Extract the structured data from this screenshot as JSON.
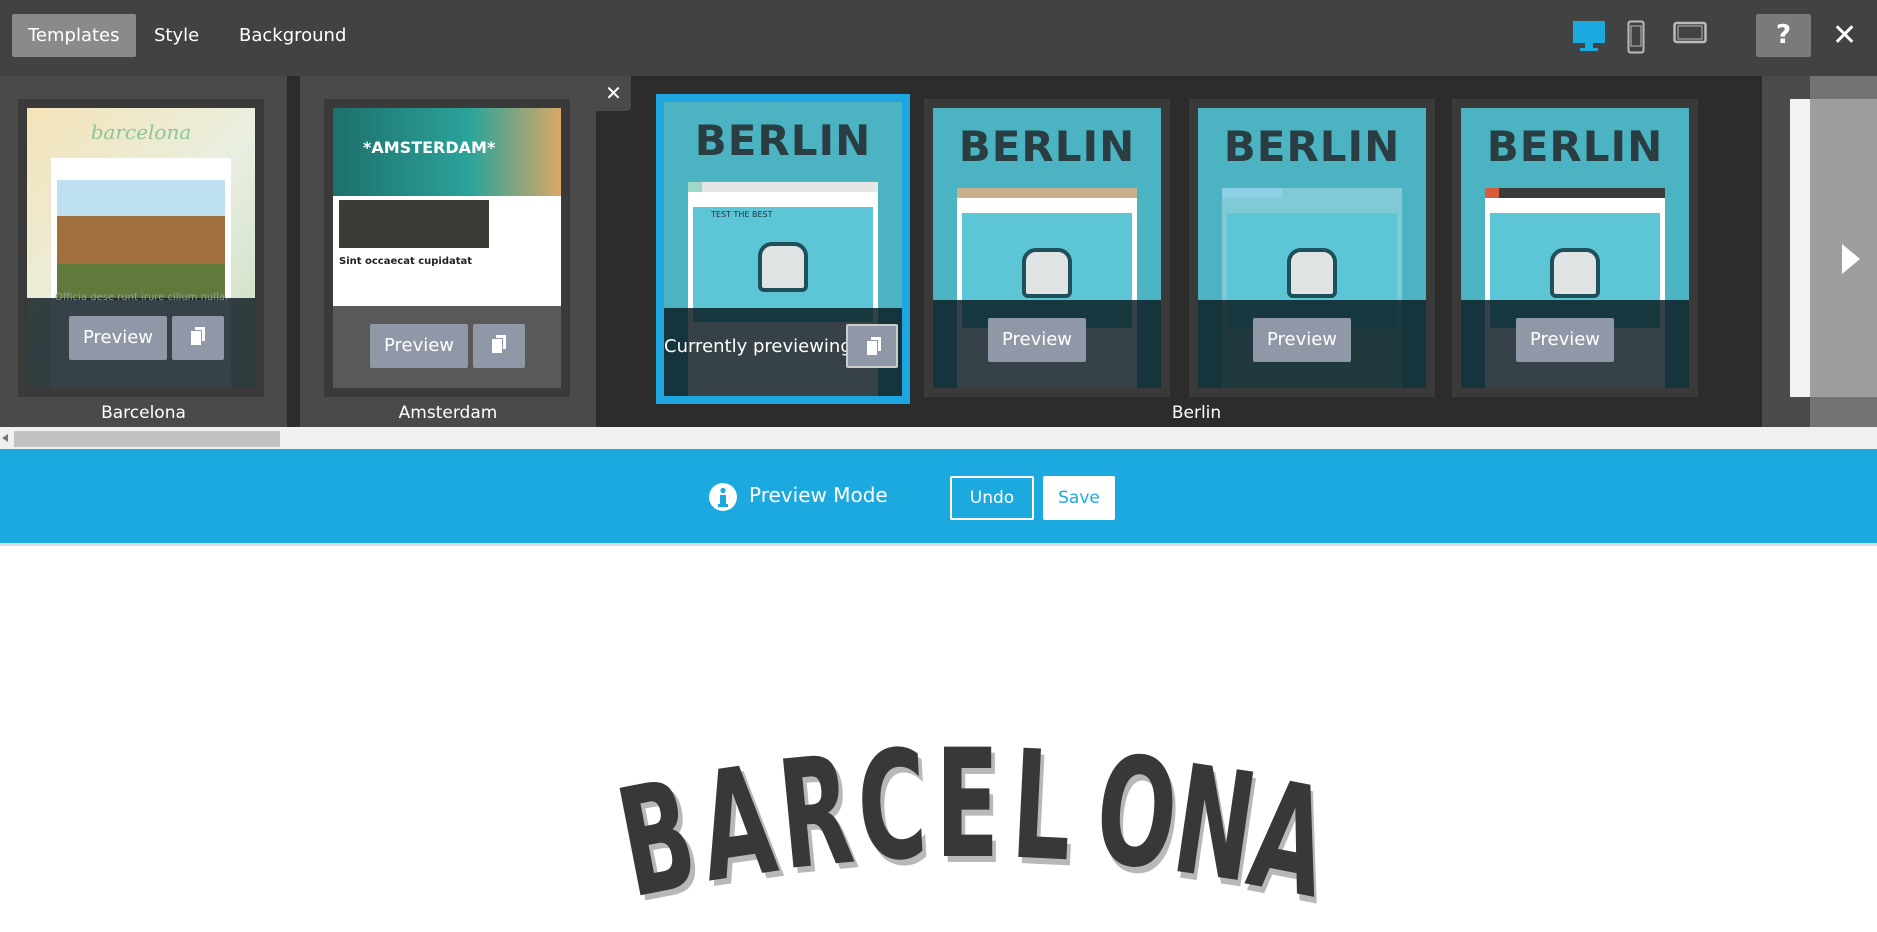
{
  "topbar": {
    "tabs": [
      {
        "label": "Templates",
        "active": true
      },
      {
        "label": "Style"
      },
      {
        "label": "Background"
      }
    ],
    "devices": [
      {
        "icon": "desktop-icon",
        "active": true
      },
      {
        "icon": "phone-icon"
      },
      {
        "icon": "tablet-icon"
      }
    ],
    "help_label": "?",
    "close_label": "✕"
  },
  "templates": {
    "close_group_label": "✕",
    "groups": [
      {
        "name": "Barcelona",
        "preview_label": "Preview",
        "thumb_title": "barcelona",
        "thumb_caption": "Officia dese runt irure cillum nulla."
      },
      {
        "name": "Amsterdam",
        "preview_label": "Preview",
        "thumb_title": "*AMSTERDAM*",
        "thumb_heading": "Sint occaecat cupidatat"
      },
      {
        "name": "Berlin",
        "variants": [
          {
            "title": "BERLIN",
            "status": "Currently previewing",
            "selected": true,
            "nav_color": "#9fd8c8"
          },
          {
            "title": "BERLIN",
            "preview_label": "Preview",
            "nav_color": "#c9b08a"
          },
          {
            "title": "BERLIN",
            "preview_label": "Preview",
            "nav_color": "#8fd0e6"
          },
          {
            "title": "BERLIN",
            "preview_label": "Preview",
            "nav_color": "#3a3a3a"
          }
        ],
        "thumb_image_text": "TEST THE BEST"
      }
    ]
  },
  "preview_bar": {
    "label": "Preview Mode",
    "undo": "Undo",
    "save": "Save",
    "color": "#1ca9e0"
  },
  "page": {
    "logo_text": "BARCELONA"
  }
}
